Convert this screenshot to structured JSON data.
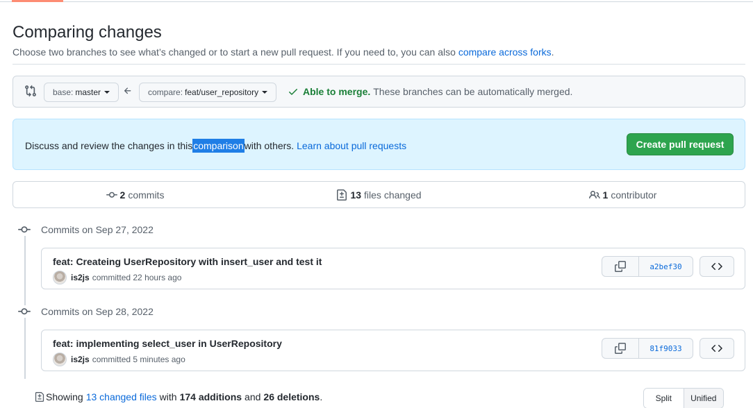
{
  "header": {
    "title": "Comparing changes",
    "subtitle": "Choose two branches to see what’s changed or to start a new pull request. If you need to, you can also",
    "subtitle_link": "compare across forks",
    "subtitle_end": "."
  },
  "range": {
    "base_prefix": "base:",
    "base_value": "master",
    "compare_prefix": "compare:",
    "compare_value": "feat/user_repository",
    "merge_status": "Able to merge.",
    "merge_detail": "These branches can be automatically merged."
  },
  "blankslate": {
    "text_before": "Discuss and review the changes in this",
    "highlight": "comparison",
    "text_after": "with others.",
    "link": "Learn about pull requests",
    "create_button": "Create pull request"
  },
  "summary": {
    "commits_count": "2",
    "commits_label": "commits",
    "files_count": "13",
    "files_label": "files changed",
    "contributors_count": "1",
    "contributors_label": "contributor"
  },
  "commit_groups": [
    {
      "date": "Commits on Sep 27, 2022",
      "commit": {
        "title": "feat: Createing UserRepository with insert_user and test it",
        "author": "is2js",
        "meta": "committed 22 hours ago",
        "sha": "a2bef30"
      }
    },
    {
      "date": "Commits on Sep 28, 2022",
      "commit": {
        "title": "feat: implementing select_user in UserRepository",
        "author": "is2js",
        "meta": "committed 5 minutes ago",
        "sha": "81f9033"
      }
    }
  ],
  "files_summary": {
    "showing": "Showing",
    "files_link": "13 changed files",
    "with": "with",
    "additions": "174 additions",
    "and": "and",
    "deletions": "26 deletions",
    "end": "."
  },
  "diff_view": {
    "split": "Split",
    "unified": "Unified",
    "selected": "Unified"
  },
  "colors": {
    "primary_button": "#2da44e",
    "link": "#0969da",
    "success": "#1a7f37",
    "info_bg": "#ddf4ff",
    "tab_accent": "#fd8c73"
  },
  "icons": {
    "range": "git-compare-icon",
    "arrow": "arrow-left-icon",
    "check": "check-icon",
    "commits": "git-commit-icon",
    "files": "file-diff-icon",
    "people": "people-icon",
    "copy": "copy-icon",
    "code": "code-icon"
  }
}
